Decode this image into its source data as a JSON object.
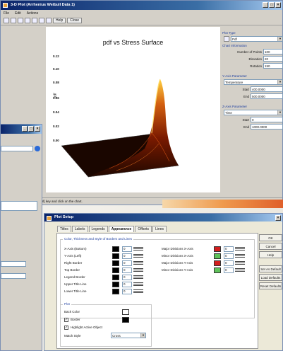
{
  "main_window": {
    "title": "3-D Plot (Arrhenius Weibull Data 1)",
    "menu": [
      "File",
      "Edit",
      "Actions"
    ],
    "toolbar": {
      "help_label": "Help",
      "close_label": "Close"
    },
    "status": "the Chart hold down the [Ctrl] key and click on the chart."
  },
  "chart": {
    "title": "pdf vs Stress Surface",
    "ylabel": "pdf",
    "yticks": [
      "0.12",
      "0.10",
      "0.08",
      "0.06",
      "0.04",
      "0.02",
      "0.00"
    ]
  },
  "panel": {
    "plot_type_label": "Plot Type",
    "plot_type_value": "Pdf",
    "chart_info_label": "Chart Information",
    "num_points_label": "Number of Points",
    "num_points_value": "100",
    "elevation_label": "Elevation",
    "elevation_value": "20",
    "rotation_label": "Rotation",
    "rotation_value": "150",
    "yaxis_param_label": "Y-Axis Parameter",
    "yaxis_param_value": "Temperature",
    "y_start_label": "Start",
    "y_start_value": "400.0000",
    "y_end_label": "End",
    "y_end_value": "500.0000",
    "zaxis_param_label": "Z-Axis Parameter",
    "zaxis_param_value": "Time",
    "z_start_label": "Start",
    "z_start_value": "0",
    "z_end_label": "End",
    "z_end_value": "1000.0000"
  },
  "setup": {
    "title": "Plot Setup",
    "tabs": [
      "Titles",
      "Labels",
      "Legends",
      "Appearance",
      "Offsets",
      "Lines"
    ],
    "group1_title": "Color, Thickness and Style of Borders and Lines",
    "left_rows": [
      "X-Axis (Bottom)",
      "Y-Axis (Left)",
      "Right Border",
      "Top Border",
      "Legend Border",
      "Upper Title Line",
      "Lower Title Line"
    ],
    "right_rows": [
      "Major Divisions X-Axis",
      "Minor Divisions X-Axis",
      "Major Divisions Y-Axis",
      "Minor Divisions Y-Axis"
    ],
    "spin_value": "0",
    "group2_title": "Plot",
    "back_color_label": "Back Color",
    "border_label": "Border",
    "highlight_label": "Highlight Active Object",
    "match_style_label": "Match Style",
    "match_style_value": "Cross",
    "buttons": [
      "OK",
      "Cancel",
      "Help",
      "Set As Default",
      "Load Defaults",
      "Reset Defaults"
    ]
  }
}
